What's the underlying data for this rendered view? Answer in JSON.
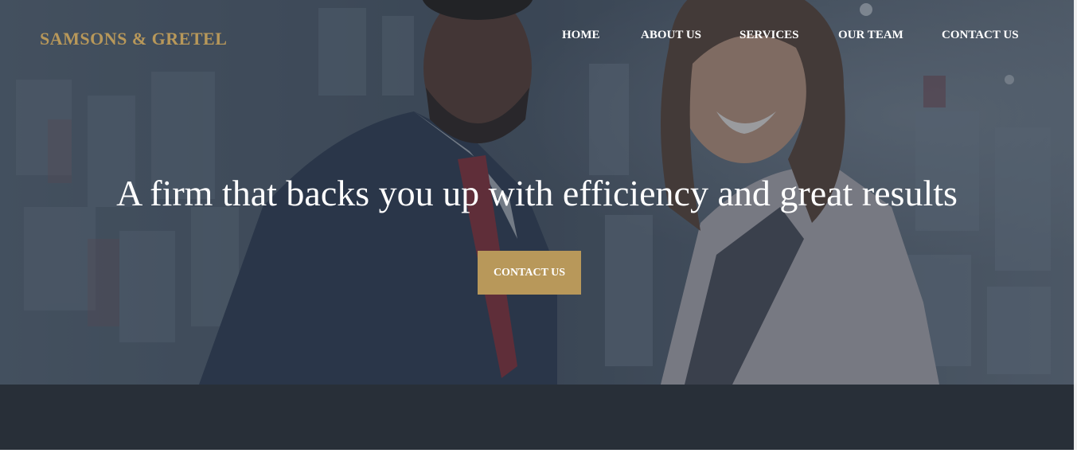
{
  "header": {
    "logo_text": "SAMSONS & GRETEL"
  },
  "nav": {
    "items": [
      {
        "label": "HOME"
      },
      {
        "label": "ABOUT US"
      },
      {
        "label": "SERVICES"
      },
      {
        "label": "OUR TEAM"
      },
      {
        "label": "CONTACT US"
      }
    ]
  },
  "hero": {
    "headline": "A firm that backs you up with efficiency and great results",
    "cta_label": "CONTACT US"
  },
  "colors": {
    "accent": "#b8985a",
    "nav_text": "#ffffff",
    "dark_band": "#282f38",
    "hero_overlay": "#4e5a6a"
  },
  "icons": []
}
